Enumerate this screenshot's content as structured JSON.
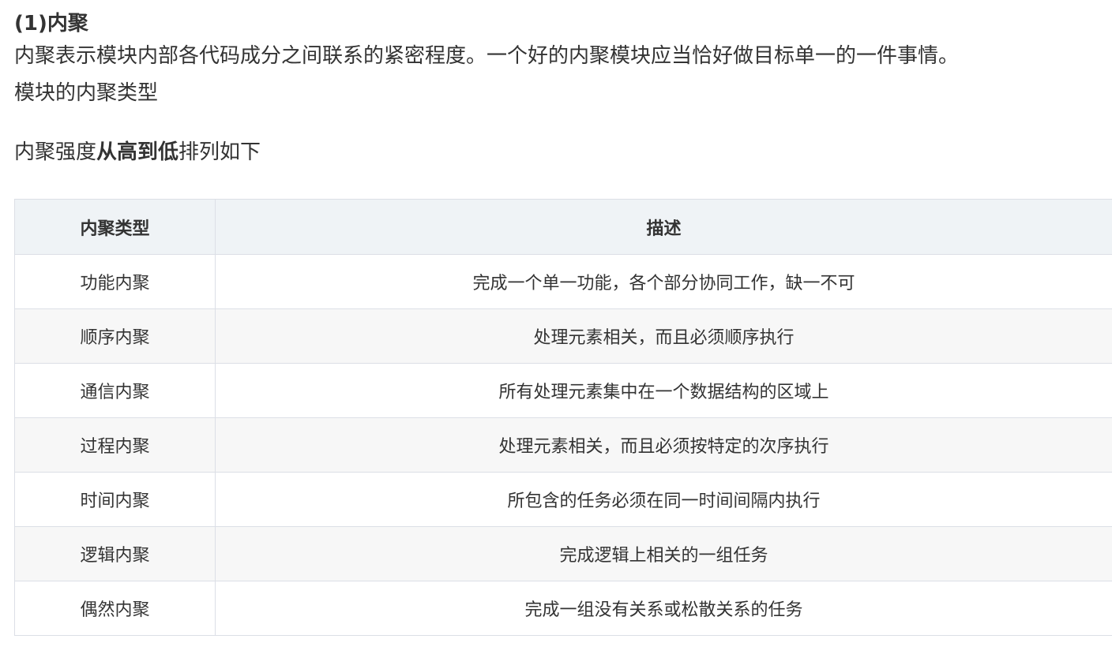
{
  "heading": "(1)内聚",
  "paragraphs": {
    "definition": "内聚表示模块内部各代码成分之间联系的紧密程度。一个好的内聚模块应当恰好做目标单一的一件事情。",
    "types_title": "模块的内聚类型",
    "order_prefix": "内聚强度",
    "order_bold": "从高到低",
    "order_suffix": "排列如下"
  },
  "table": {
    "headers": [
      "内聚类型",
      "描述"
    ],
    "rows": [
      [
        "功能内聚",
        "完成一个单一功能，各个部分协同工作，缺一不可"
      ],
      [
        "顺序内聚",
        "处理元素相关，而且必须顺序执行"
      ],
      [
        "通信内聚",
        "所有处理元素集中在一个数据结构的区域上"
      ],
      [
        "过程内聚",
        "处理元素相关，而且必须按特定的次序执行"
      ],
      [
        "时间内聚",
        "所包含的任务必须在同一时间间隔内执行"
      ],
      [
        "逻辑内聚",
        "完成逻辑上相关的一组任务"
      ],
      [
        "偶然内聚",
        "完成一组没有关系或松散关系的任务"
      ]
    ]
  }
}
